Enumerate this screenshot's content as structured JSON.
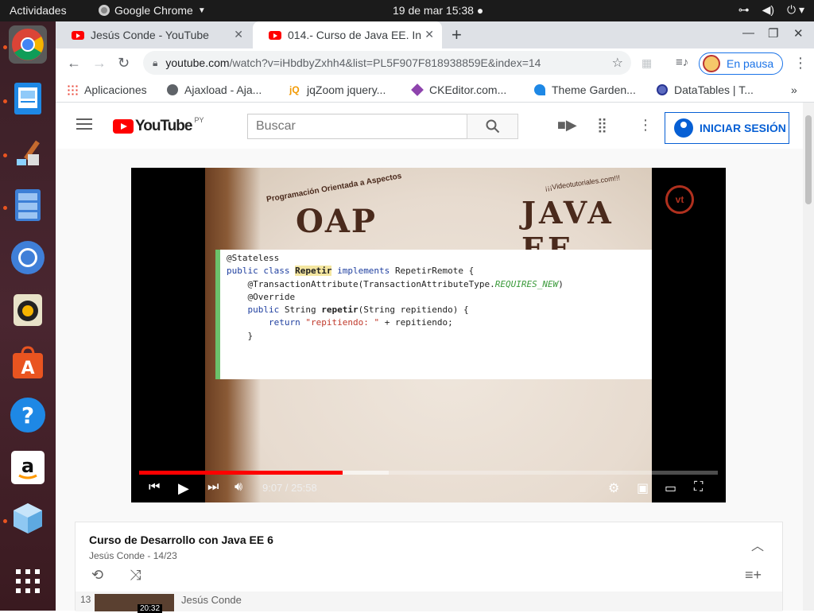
{
  "system": {
    "activities": "Actividades",
    "app_name": "Google Chrome",
    "clock": "19 de mar  15:38 ●",
    "tray_icons": [
      "network-icon",
      "volume-icon",
      "power-icon"
    ]
  },
  "dock": {
    "items": [
      "chrome",
      "document-viewer",
      "paint",
      "file-cabinet",
      "chromium",
      "rhythmbox",
      "software-center",
      "help",
      "amazon",
      "virtualbox",
      "show-apps"
    ]
  },
  "tabs": [
    {
      "title": "Jesús Conde - YouTube",
      "active": false
    },
    {
      "title": "014.- Curso de Java EE. Int",
      "active": true
    }
  ],
  "toolbar": {
    "url_host": "youtube.com",
    "url_rest": "/watch?v=iHbdbyZxhh4&list=PL5F907F818938859E&index=14",
    "profile_label": "En pausa"
  },
  "bookmarks": [
    {
      "label": "Aplicaciones",
      "icon": "apps-grid-icon"
    },
    {
      "label": "Ajaxload - Aja...",
      "icon": "globe-icon"
    },
    {
      "label": "jqZoom jquery...",
      "icon": "jq-icon"
    },
    {
      "label": "CKEditor.com...",
      "icon": "ckeditor-icon"
    },
    {
      "label": "Theme Garden...",
      "icon": "theme-icon"
    },
    {
      "label": "DataTables | T...",
      "icon": "datatables-icon"
    }
  ],
  "youtube": {
    "logo_word": "YouTube",
    "country": "PY",
    "search_placeholder": "Buscar",
    "signin_label": "INICIAR SESIÓN"
  },
  "video": {
    "slide_oap": "OAP",
    "slide_oap_sub": "Programación Orientada a Aspectos",
    "slide_java": "JAVA EE",
    "slide_site": "¡¡¡Videotutoriales.com!!!",
    "code_lines": [
      "@Stateless",
      "public class Repetir implements RepetirRemote {",
      "",
      "    @TransactionAttribute(TransactionAttributeType.REQUIRES_NEW)",
      "    @Override",
      "    public String repetir(String repitiendo) {",
      "        return \"repitiendo: \" + repitiendo;",
      "",
      "    }"
    ],
    "time": "9:07 / 25:58",
    "progress": 0.351
  },
  "playlist": {
    "title": "Curso de Desarrollo con Java EE 6",
    "author": "Jesús Conde",
    "position": "14/23",
    "rows": [
      {
        "num": "13",
        "duration": "20:32",
        "author": "Jesús Conde"
      }
    ]
  },
  "colors": {
    "youtube_red": "#ff0000",
    "link_blue": "#065fd4",
    "ubuntu_orange": "#e95420"
  }
}
